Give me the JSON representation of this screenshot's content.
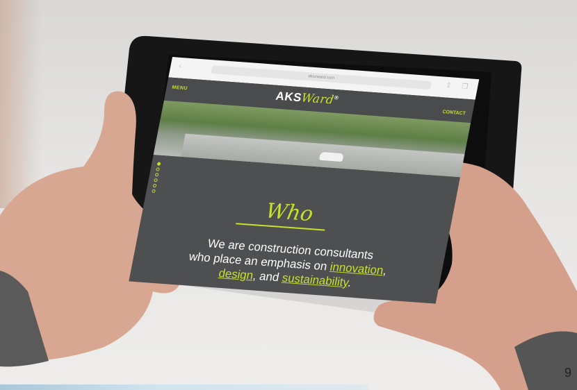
{
  "browser": {
    "url": "akscward.com",
    "back_icon": "back-arrow-icon",
    "share_icon": "share-icon",
    "tabs_icon": "tabs-icon"
  },
  "site": {
    "menu_label": "MENU",
    "logo_text": "AKS",
    "logo_accent": "Ward",
    "logo_mark": "®",
    "contact_label": "CONTACT",
    "heading": "Who",
    "tagline_line1": "We are construction consultants",
    "tagline_line2_prefix": "who place an emphasis on ",
    "tagline_hl1": "innovation",
    "tagline_line2_suffix": ",",
    "tagline_hl2": "design",
    "tagline_line3_mid": ", and ",
    "tagline_hl3": "sustainability",
    "tagline_line3_suffix": ".",
    "accent_color": "#c9e02a",
    "panel_color": "#4e4f51"
  },
  "slide_number": "9"
}
